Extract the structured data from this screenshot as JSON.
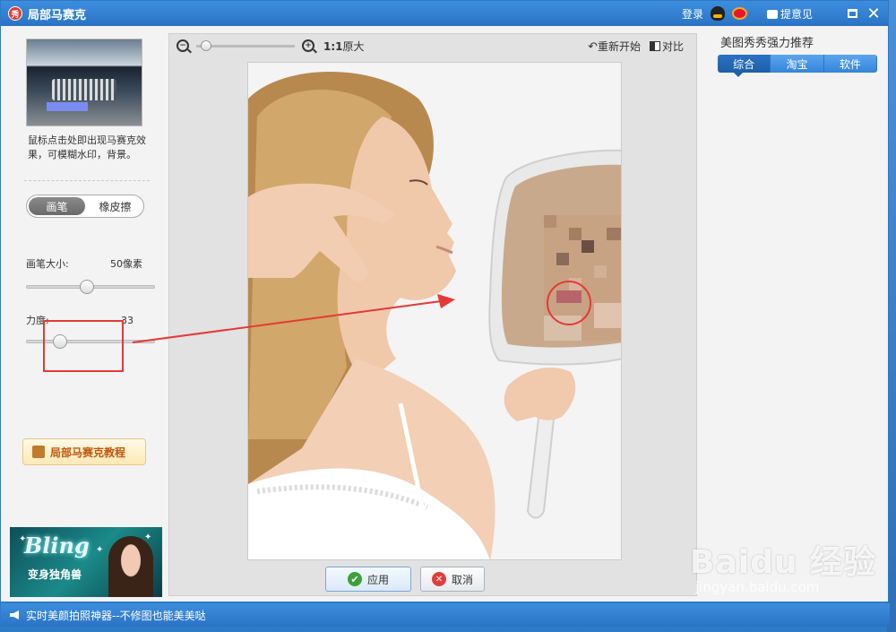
{
  "window": {
    "title": "局部马赛克",
    "logo_text": "秀",
    "login": "登录",
    "feedback": "提意见"
  },
  "left": {
    "thumb_caption": "鼠标点击处即出现马赛克效果，可模糊水印，背景。",
    "toggle": {
      "brush": "画笔",
      "eraser": "橡皮擦",
      "active": "brush"
    },
    "brush_size_label": "画笔大小:",
    "brush_size_value": "50像素",
    "brush_size_fraction": 0.47,
    "strength_label": "力度:",
    "strength_value": "33",
    "strength_fraction": 0.26,
    "tutorial_button": "局部马赛克教程",
    "ad": {
      "headline": "Bling",
      "sub": "变身独角兽"
    }
  },
  "canvas": {
    "ratio_prefix": "1:1",
    "ratio_label": "原大",
    "restart": "重新开始",
    "compare": "对比",
    "zoom_fraction": 0.12,
    "apply": "应用",
    "cancel": "取消"
  },
  "right": {
    "title": "美图秀秀强力推荐",
    "tabs": [
      "综合",
      "淘宝",
      "软件"
    ],
    "active_tab": 0
  },
  "status": {
    "text": "实时美颜拍照神器--不修图也能美美哒"
  },
  "watermark": {
    "brand": "Baidu 经验",
    "url": "jingyan.baidu.com"
  },
  "colors": {
    "title_bar": "#2a73c4",
    "annotation": "#e53935",
    "tab_active": "#1d5fa8"
  }
}
